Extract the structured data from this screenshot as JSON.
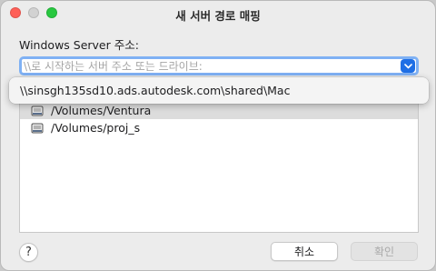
{
  "window": {
    "title": "새 서버 경로 매핑"
  },
  "colors": {
    "close": "#ff5f57",
    "minimize": "#d2d2d2",
    "zoom": "#28c840",
    "accent": "#1f6fe5",
    "focus_ring": "#7fb1f4"
  },
  "form": {
    "label": "Windows Server 주소:",
    "input_value": "",
    "placeholder": "\\\\로 시작하는 서버 주소 또는 드라이브:"
  },
  "dropdown": {
    "suggestion": "\\\\sinsgh135sd10.ads.autodesk.com\\shared\\Mac"
  },
  "list": {
    "items": [
      {
        "label": "/Volumes/Ventura",
        "icon": "disk-icon",
        "selected": true
      },
      {
        "label": "/Volumes/proj_s",
        "icon": "disk-icon",
        "selected": false
      }
    ]
  },
  "footer": {
    "help_label": "?",
    "cancel_label": "취소",
    "ok_label": "확인"
  }
}
